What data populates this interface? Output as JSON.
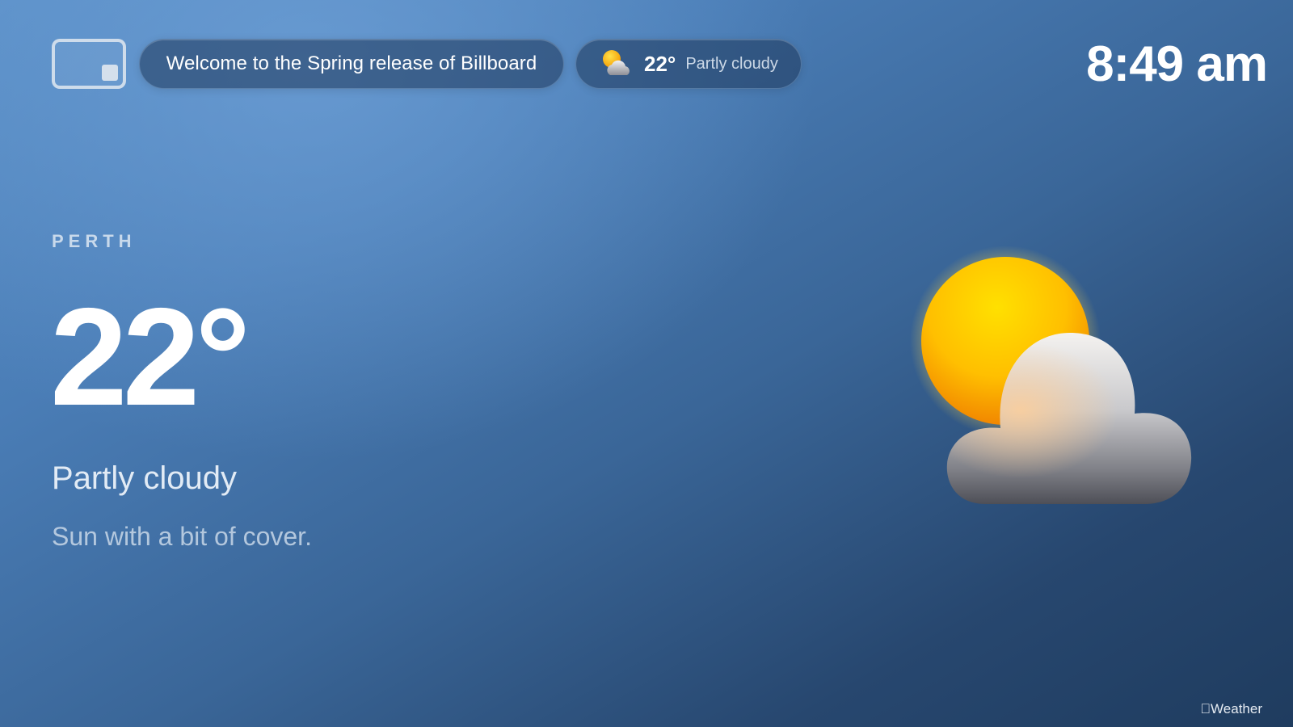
{
  "header": {
    "welcome_text": "Welcome to the Spring release of Billboard",
    "weather_pill": {
      "icon": "partly-cloudy-icon",
      "temperature": "22°",
      "condition": "Partly cloudy"
    },
    "time": "8:49 am"
  },
  "main": {
    "city": "PERTH",
    "temperature": "22°",
    "condition": "Partly cloudy",
    "description": "Sun with a bit of cover.",
    "icon": "partly-cloudy-icon"
  },
  "footer": {
    "attribution": "Weather",
    "attribution_icon": "apple-logo-icon"
  },
  "colors": {
    "background_top": "#5a8fc7",
    "background_bottom": "#1f3c5f",
    "sun": "#ffc800",
    "cloud": "#9a9a9e"
  }
}
